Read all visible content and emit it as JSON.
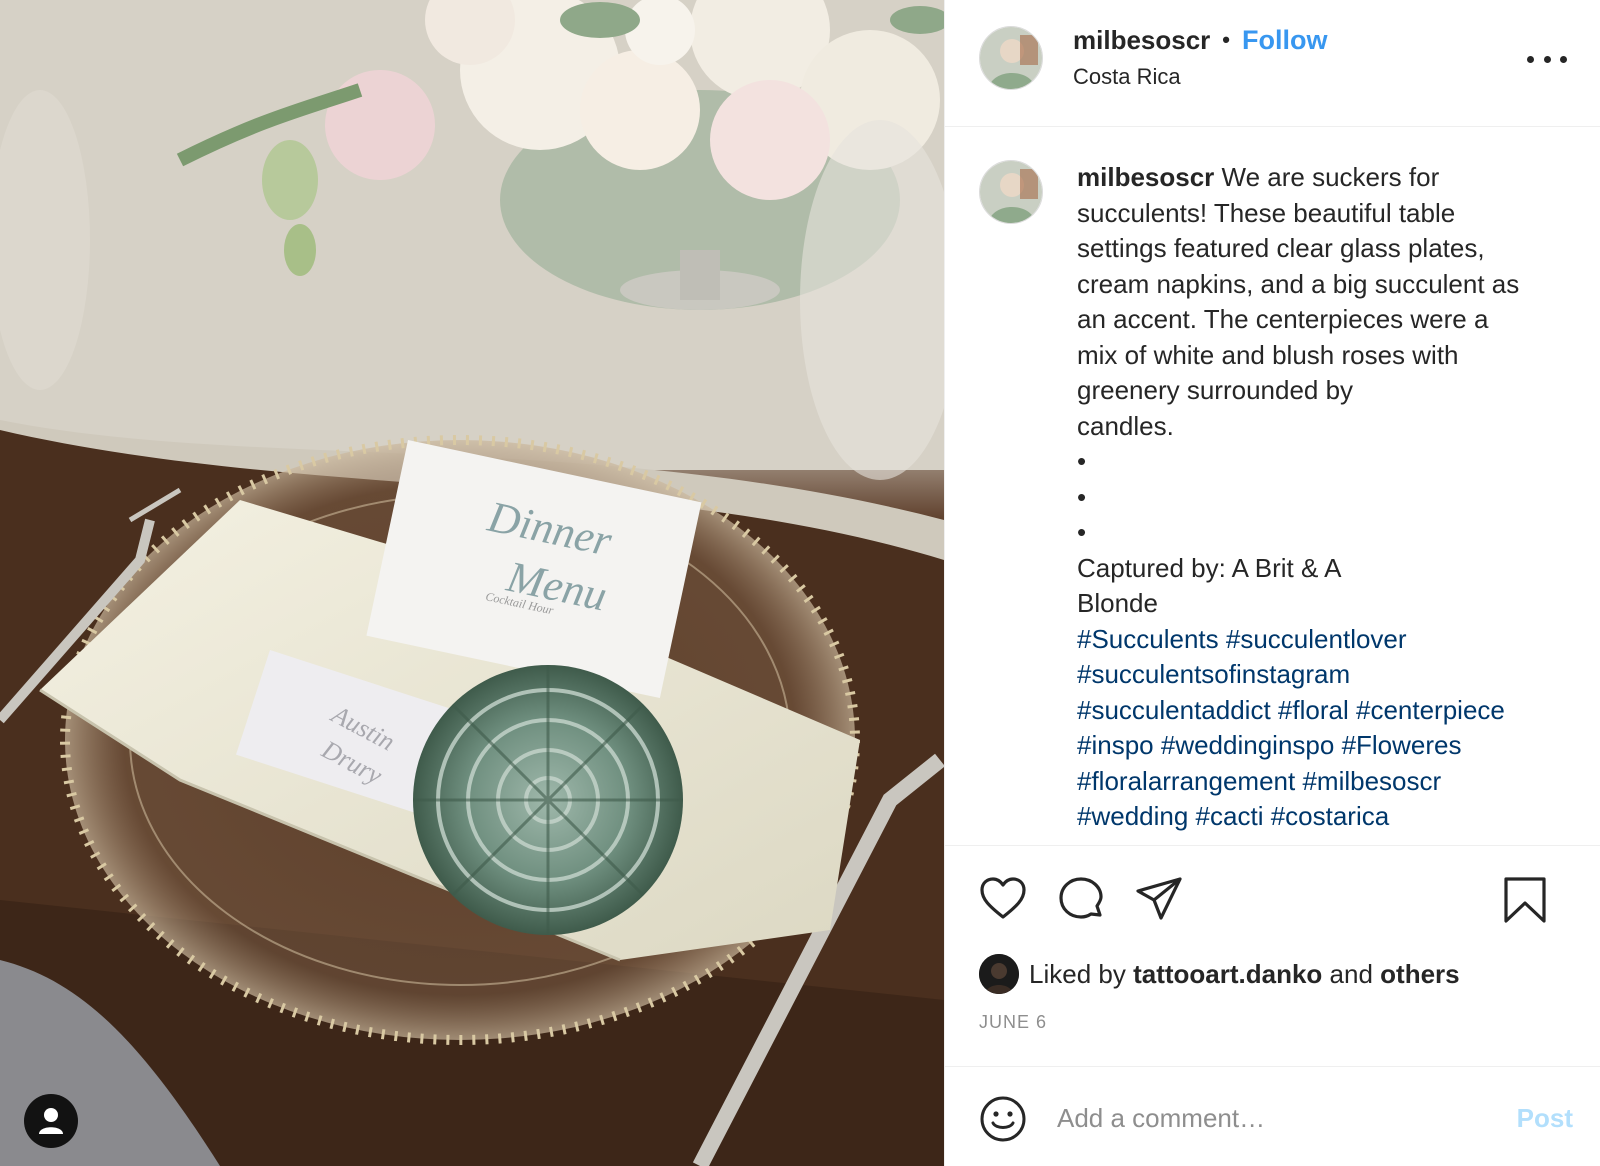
{
  "post": {
    "username": "milbesoscr",
    "separator": "•",
    "follow_label": "Follow",
    "location": "Costa Rica",
    "more_icon": "more-horizontal-icon"
  },
  "caption": {
    "username": "milbesoscr",
    "lines": [
      "We are suckers for",
      "succulents! These beautiful table",
      "settings featured clear glass plates,",
      "cream napkins, and a big succulent as",
      "an accent. The centerpieces were a",
      "mix of white and blush roses with",
      "greenery surrounded by",
      "candles.",
      "•",
      "•",
      "•",
      "Captured by: A Brit & A",
      "Blonde"
    ],
    "hashtags": [
      [
        "#Succulents",
        "#succulentlover"
      ],
      [
        "#succulentsofinstagram"
      ],
      [
        "#succulentaddict",
        "#floral",
        "#centerpiece"
      ],
      [
        "#inspo",
        "#weddinginspo",
        "#Floweres"
      ],
      [
        "#floralarrangement",
        "#milbesoscr"
      ],
      [
        "#wedding",
        "#cacti",
        "#costarica"
      ]
    ]
  },
  "actions": {
    "like_icon": "heart-icon",
    "comment_icon": "comment-icon",
    "share_icon": "paper-plane-icon",
    "save_icon": "bookmark-icon"
  },
  "likes": {
    "prefix": "Liked by",
    "user": "tattooart.danko",
    "conjunction": "and",
    "others": "others"
  },
  "date": "JUNE 6",
  "comment": {
    "placeholder": "Add a comment…",
    "post_label": "Post"
  },
  "photo_card": {
    "menu_line1": "Dinner",
    "menu_line2": "Menu",
    "menu_sub": "Cocktail Hour",
    "place_line1": "Austin",
    "place_line2": "Drury"
  },
  "colors": {
    "link_blue": "#3897f0",
    "hashtag_blue": "#00376b",
    "post_disabled": "#b2dffc",
    "muted": "#8e8e8e"
  }
}
